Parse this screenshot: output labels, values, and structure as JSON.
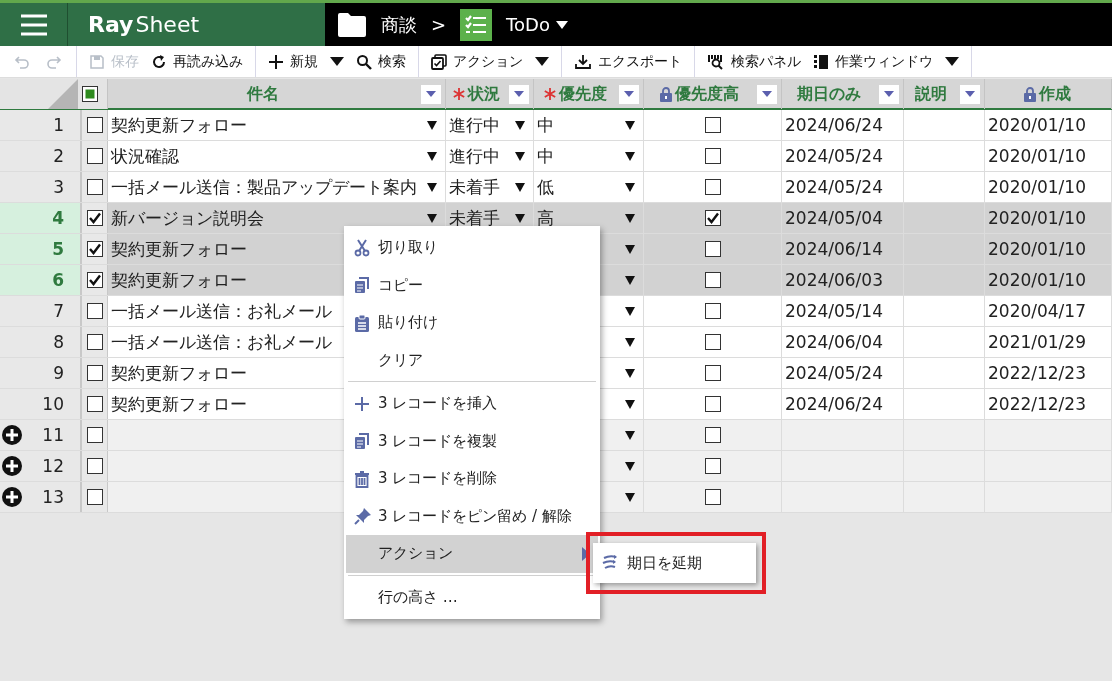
{
  "app": {
    "logo_ray": "Ray",
    "logo_sheet": "Sheet"
  },
  "breadcrumb": [
    {
      "label": "商談"
    },
    {
      "label": ">"
    },
    {
      "label": "ToDo",
      "caret": true
    }
  ],
  "toolbar": [
    {
      "items": [
        {
          "kind": "icon",
          "disabled": true
        },
        {
          "kind": "icon",
          "disabled": true
        }
      ]
    },
    {
      "items": [
        {
          "kind": "button",
          "label": "保存",
          "disabled": true
        },
        {
          "kind": "button",
          "label": "再読み込み",
          "disabled": false
        }
      ]
    },
    {
      "items": [
        {
          "kind": "button",
          "label": "新規",
          "disabled": false,
          "caret": true
        },
        {
          "kind": "button",
          "label": "検索",
          "disabled": false
        }
      ]
    },
    {
      "items": [
        {
          "kind": "button",
          "label": "アクション",
          "disabled": false,
          "caret": true
        }
      ]
    },
    {
      "items": [
        {
          "kind": "button",
          "label": "エクスポート",
          "disabled": false
        }
      ]
    },
    {
      "items": [
        {
          "kind": "button",
          "label": "検索パネル",
          "disabled": false
        },
        {
          "kind": "button",
          "label": "作業ウィンドウ",
          "disabled": false,
          "caret": true
        }
      ]
    }
  ],
  "table": {
    "select_all": {
      "partial": true
    },
    "columns": [
      {
        "name": "件名",
        "required": false,
        "locked": false,
        "filter": true
      },
      {
        "name": "状況",
        "required": true,
        "locked": false,
        "filter": true
      },
      {
        "name": "優先度",
        "required": true,
        "locked": false,
        "filter": true
      },
      {
        "name": "優先度高",
        "required": false,
        "locked": true,
        "filter": true
      },
      {
        "name": "期日のみ",
        "required": false,
        "locked": false,
        "filter": true
      },
      {
        "name": "説明",
        "required": false,
        "locked": false,
        "filter": true
      },
      {
        "name": "作成",
        "required": false,
        "locked": true,
        "filter": false
      }
    ],
    "rows": [
      {
        "kind": "record",
        "number": "1",
        "selected": false,
        "checked": false,
        "title": "契約更新フォロー",
        "status": "進行中",
        "priority": "中",
        "high": false,
        "due": "2024/06/24",
        "created": "2020/01/10"
      },
      {
        "kind": "record",
        "number": "2",
        "selected": false,
        "checked": false,
        "title": "状況確認",
        "status": "進行中",
        "priority": "中",
        "high": false,
        "due": "2024/05/24",
        "created": "2020/01/10"
      },
      {
        "kind": "record",
        "number": "3",
        "selected": false,
        "checked": false,
        "title": "一括メール送信：製品アップデート案内",
        "status": "未着手",
        "priority": "低",
        "high": false,
        "due": "2024/05/24",
        "created": "2020/01/10"
      },
      {
        "kind": "record",
        "number": "4",
        "selected": true,
        "checked": true,
        "title": "新バージョン説明会",
        "status": "未着手",
        "priority": "高",
        "high": true,
        "due": "2024/05/04",
        "created": "2020/01/10"
      },
      {
        "kind": "record",
        "number": "5",
        "selected": true,
        "checked": true,
        "title": "契約更新フォロー",
        "high": false,
        "due": "2024/06/14",
        "created": "2020/01/10"
      },
      {
        "kind": "record",
        "number": "6",
        "selected": true,
        "checked": true,
        "title": "契約更新フォロー",
        "high": false,
        "due": "2024/06/03",
        "created": "2020/01/10"
      },
      {
        "kind": "record",
        "number": "7",
        "selected": false,
        "checked": false,
        "title": "一括メール送信：お礼メール",
        "high": false,
        "due": "2024/05/14",
        "created": "2020/04/17"
      },
      {
        "kind": "record",
        "number": "8",
        "selected": false,
        "checked": false,
        "title": "一括メール送信：お礼メール",
        "high": false,
        "due": "2024/06/04",
        "created": "2021/01/29"
      },
      {
        "kind": "record",
        "number": "9",
        "selected": false,
        "checked": false,
        "title": "契約更新フォロー",
        "high": false,
        "due": "2024/05/24",
        "created": "2022/12/23"
      },
      {
        "kind": "record",
        "number": "10",
        "selected": false,
        "checked": false,
        "title": "契約更新フォロー",
        "high": false,
        "due": "2024/06/24",
        "created": "2022/12/23"
      },
      {
        "kind": "new",
        "number": "11",
        "selected": false,
        "checked": false,
        "high": false
      },
      {
        "kind": "new",
        "number": "12",
        "selected": false,
        "checked": false,
        "high": false
      },
      {
        "kind": "new",
        "number": "13",
        "selected": false,
        "checked": false,
        "high": false
      }
    ]
  },
  "context_menu": {
    "items": [
      {
        "kind": "item",
        "label": "切り取り",
        "selected": false
      },
      {
        "kind": "item",
        "label": "コピー",
        "selected": false
      },
      {
        "kind": "item",
        "label": "貼り付け",
        "selected": false
      },
      {
        "kind": "item",
        "label": "クリア",
        "selected": false
      },
      {
        "kind": "separator"
      },
      {
        "kind": "item",
        "label": "3 レコードを挿入",
        "selected": false
      },
      {
        "kind": "item",
        "label": "3 レコードを複製",
        "selected": false
      },
      {
        "kind": "item",
        "label": "3 レコードを削除",
        "selected": false
      },
      {
        "kind": "item",
        "label": "3 レコードをピン留め / 解除",
        "selected": false
      },
      {
        "kind": "submenu",
        "label": "アクション",
        "selected": true
      },
      {
        "kind": "separator"
      },
      {
        "kind": "item",
        "label": "行の高さ …",
        "selected": false
      }
    ],
    "submenu": {
      "highlighted": true,
      "items": [
        {
          "label": "期日を延期"
        }
      ]
    }
  }
}
